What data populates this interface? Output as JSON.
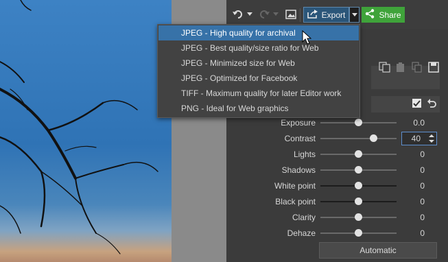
{
  "toolbar": {
    "export_label": "Export",
    "share_label": "Share"
  },
  "export_menu": {
    "items": [
      {
        "label": "JPEG - High quality for archival",
        "selected": true
      },
      {
        "label": "JPEG - Best quality/size ratio for Web",
        "selected": false
      },
      {
        "label": "JPEG - Minimized size for Web",
        "selected": false
      },
      {
        "label": "JPEG - Optimized for Facebook",
        "selected": false
      },
      {
        "label": "TIFF - Maximum quality for later Editor work",
        "selected": false
      },
      {
        "label": "PNG - Ideal for Web graphics",
        "selected": false
      }
    ]
  },
  "adjustments": [
    {
      "label": "Exposure",
      "value": "0.0",
      "slider_fraction": 0.5
    },
    {
      "label": "Contrast",
      "value": "40",
      "slider_fraction": 0.7
    },
    {
      "label": "Lights",
      "value": "0",
      "slider_fraction": 0.5
    },
    {
      "label": "Shadows",
      "value": "0",
      "slider_fraction": 0.5
    },
    {
      "label": "White point",
      "value": "0",
      "slider_fraction": 0.5
    },
    {
      "label": "Black point",
      "value": "0",
      "slider_fraction": 0.5
    },
    {
      "label": "Clarity",
      "value": "0",
      "slider_fraction": 0.5
    },
    {
      "label": "Dehaze",
      "value": "0",
      "slider_fraction": 0.5
    }
  ],
  "automatic_label": "Automatic",
  "colors": {
    "accent_blue": "#3772a8",
    "share_green": "#3fa33a"
  }
}
